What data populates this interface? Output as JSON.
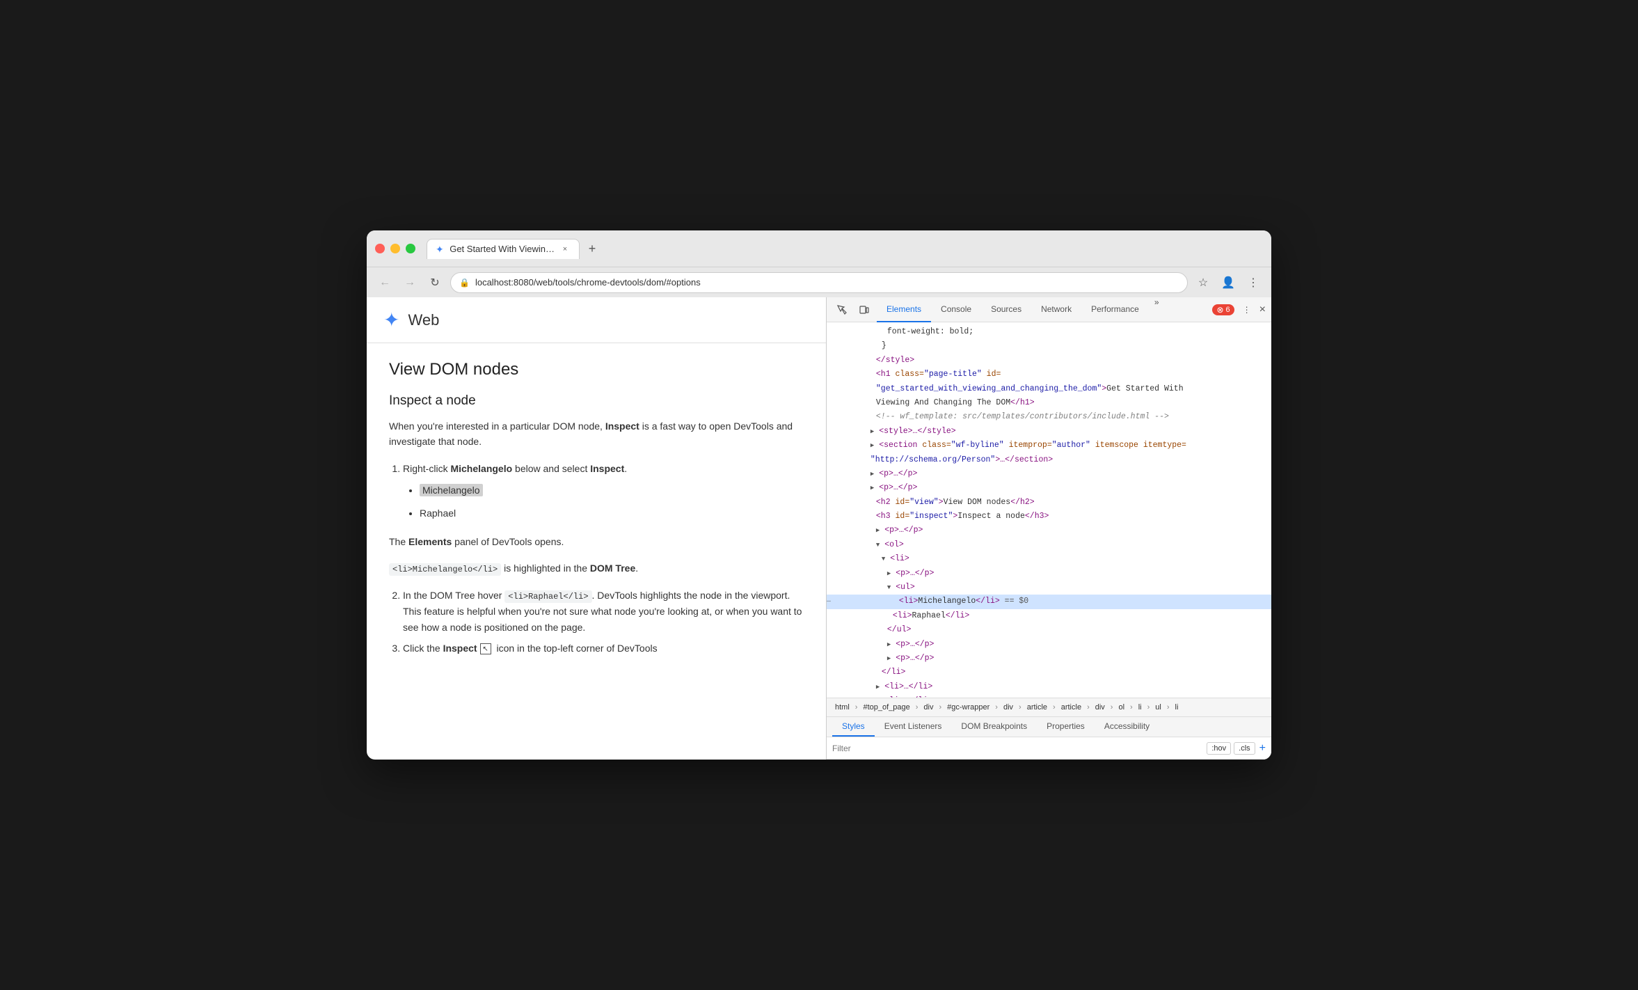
{
  "browser": {
    "traffic_lights": [
      "red",
      "yellow",
      "green"
    ],
    "tab": {
      "favicon": "✦",
      "title": "Get Started With Viewing And",
      "close": "×"
    },
    "new_tab": "+",
    "nav": {
      "back": "←",
      "forward": "→",
      "reload": "↻"
    },
    "url": "localhost:8080/web/tools/chrome-devtools/dom/#options",
    "url_icon": "🔒",
    "star_icon": "☆",
    "profile_icon": "👤",
    "menu_icon": "⋮"
  },
  "page": {
    "logo": "✦",
    "site_name": "Web",
    "h2": "View DOM nodes",
    "h3": "Inspect a node",
    "intro_p": "When you're interested in a particular DOM node, Inspect is a fast way to open DevTools and investigate that node.",
    "step1_prefix": "Right-click ",
    "step1_bold1": "Michelangelo",
    "step1_suffix": " below and select ",
    "step1_bold2": "Inspect",
    "step1_end": ".",
    "list_item1": "Michelangelo",
    "list_item2": "Raphael",
    "elements_note_prefix": "The ",
    "elements_note_bold": "Elements",
    "elements_note_suffix": " panel of DevTools opens.",
    "code_snippet": "<li>Michelangelo</li>",
    "highlighted_note_suffix": " is highlighted in the ",
    "highlighted_note_bold": "DOM Tree",
    "highlighted_note_end": ".",
    "step2_prefix": "In the DOM Tree hover ",
    "step2_code": "<li>Raphael</li>",
    "step2_suffix": ". DevTools highlights the node in the viewport. This feature is helpful when you're not sure what node you're looking at, or when you want to see how a node is positioned on the page.",
    "step3_prefix": "Click the ",
    "step3_bold": "Inspect",
    "step3_suffix": " icon in the top-left corner of DevTools"
  },
  "devtools": {
    "toolbar_icons": [
      "inspect",
      "device"
    ],
    "tabs": [
      "Elements",
      "Console",
      "Sources",
      "Network",
      "Performance"
    ],
    "tab_active": "Elements",
    "tab_more": "»",
    "error_count": "6",
    "close": "×",
    "dom_lines": [
      {
        "indent": 6,
        "content": "font-weight: bold;",
        "type": "text",
        "color": "#333"
      },
      {
        "indent": 5,
        "content": "}",
        "type": "text",
        "color": "#333"
      },
      {
        "indent": 4,
        "tag": "</style>",
        "type": "tag",
        "arrow": ""
      },
      {
        "indent": 4,
        "content": "<h1 class=\"page-title\" id=",
        "type": "tag",
        "arrow": ""
      },
      {
        "indent": 4,
        "content": "\"get_started_with_viewing_and_changing_the_dom\">Get Started With",
        "type": "attr-value",
        "arrow": ""
      },
      {
        "indent": 4,
        "content": "Viewing And Changing The DOM</h1>",
        "type": "text"
      },
      {
        "indent": 4,
        "content": "<!-- wf_template: src/templates/contributors/include.html -->",
        "type": "comment",
        "arrow": ""
      },
      {
        "indent": 4,
        "content": "<style>…</style>",
        "type": "tag",
        "arrow": "▶"
      },
      {
        "indent": 4,
        "content": "<section class=\"wf-byline\" itemprop=\"author\" itemscope itemtype=",
        "type": "tag",
        "arrow": "▶"
      },
      {
        "indent": 4,
        "content": "\"http://schema.org/Person\">…</section>",
        "type": "attr-value"
      },
      {
        "indent": 4,
        "content": "<p>…</p>",
        "type": "tag",
        "arrow": "▶"
      },
      {
        "indent": 4,
        "content": "<p>…</p>",
        "type": "tag",
        "arrow": "▶"
      },
      {
        "indent": 5,
        "content": "<h2 id=\"view\">View DOM nodes</h2>",
        "type": "tag",
        "arrow": ""
      },
      {
        "indent": 5,
        "content": "<h3 id=\"inspect\">Inspect a node</h3>",
        "type": "tag",
        "arrow": ""
      },
      {
        "indent": 5,
        "content": "<p>…</p>",
        "type": "tag",
        "arrow": "▶"
      },
      {
        "indent": 5,
        "content": "<ol>",
        "type": "tag",
        "arrow": "▼"
      },
      {
        "indent": 6,
        "content": "<li>",
        "type": "tag",
        "arrow": "▼"
      },
      {
        "indent": 7,
        "content": "<p>…</p>",
        "type": "tag",
        "arrow": "▶"
      },
      {
        "indent": 7,
        "content": "<ul>",
        "type": "tag",
        "arrow": "▼"
      },
      {
        "indent": 8,
        "content": "<li>Michelangelo</li> == $0",
        "type": "selected",
        "arrow": ""
      },
      {
        "indent": 8,
        "content": "<li>Raphael</li>",
        "type": "tag",
        "arrow": ""
      },
      {
        "indent": 7,
        "content": "</ul>",
        "type": "tag",
        "arrow": ""
      },
      {
        "indent": 7,
        "content": "<p>…</p>",
        "type": "tag",
        "arrow": "▶"
      },
      {
        "indent": 7,
        "content": "<p>…</p>",
        "type": "tag",
        "arrow": "▶"
      },
      {
        "indent": 6,
        "content": "</li>",
        "type": "tag",
        "arrow": ""
      },
      {
        "indent": 6,
        "content": "<li>…</li>",
        "type": "tag",
        "arrow": "▶"
      },
      {
        "indent": 6,
        "content": "<li>…</li>",
        "type": "tag",
        "arrow": "▶"
      }
    ],
    "breadcrumb": [
      "html",
      "#top_of_page",
      "div",
      "#gc-wrapper",
      "div",
      "article",
      "article",
      "div",
      "ol",
      "li",
      "ul",
      "li"
    ],
    "bottom_tabs": [
      "Styles",
      "Event Listeners",
      "DOM Breakpoints",
      "Properties",
      "Accessibility"
    ],
    "bottom_tab_active": "Styles",
    "filter_placeholder": "Filter",
    "filter_badges": [
      ":hov",
      ".cls"
    ],
    "filter_add": "+"
  }
}
